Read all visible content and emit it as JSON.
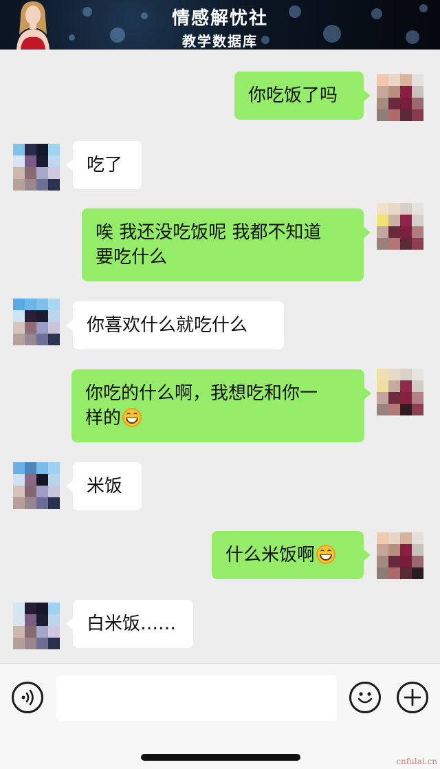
{
  "banner": {
    "title": "情感解忧社",
    "subtitle": "教学数据库"
  },
  "messages": [
    {
      "from": "me",
      "text": "你吃饭了吗"
    },
    {
      "from": "them",
      "text": "吃了"
    },
    {
      "from": "me",
      "line1": "唉 我还没吃饭呢 我都不知道",
      "line2": "要吃什么"
    },
    {
      "from": "them",
      "text": "你喜欢什么就吃什么"
    },
    {
      "from": "me",
      "line1": "你吃的什么啊，我想吃和你一",
      "line2": "样的",
      "emoji": "grin-emoji"
    },
    {
      "from": "them",
      "text": "米饭"
    },
    {
      "from": "me",
      "text": "什么米饭啊",
      "emoji": "grin-emoji"
    },
    {
      "from": "them",
      "text": "白米饭……"
    }
  ],
  "input_bar": {
    "icons": [
      "voice-icon",
      "emoji-icon",
      "plus-icon"
    ],
    "input_value": ""
  },
  "watermark": "cnfulai.cn",
  "colors": {
    "my_bubble": "#95ec69",
    "their_bubble": "#ffffff",
    "background": "#ededed"
  }
}
